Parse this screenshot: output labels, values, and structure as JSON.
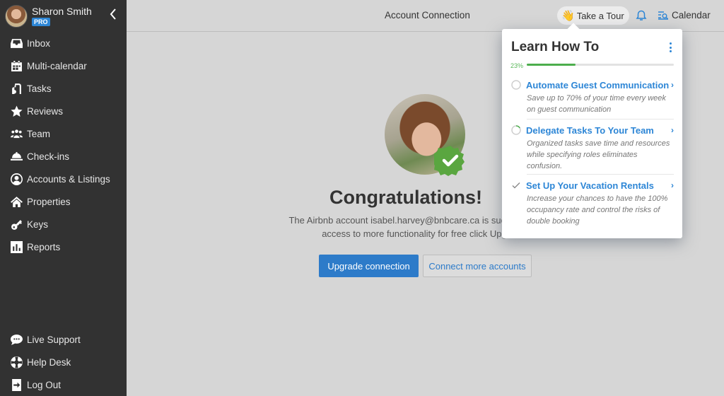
{
  "sidebar": {
    "user": {
      "name": "Sharon Smith",
      "badge": "PRO"
    },
    "collapse_icon": "chevron-left",
    "items": [
      {
        "label": "Inbox",
        "icon": "inbox-icon"
      },
      {
        "label": "Multi-calendar",
        "icon": "calendar-grid-icon"
      },
      {
        "label": "Tasks",
        "icon": "vacuum-icon"
      },
      {
        "label": "Reviews",
        "icon": "star-icon"
      },
      {
        "label": "Team",
        "icon": "team-icon"
      },
      {
        "label": "Check-ins",
        "icon": "bell-desk-icon"
      },
      {
        "label": "Accounts & Listings",
        "icon": "user-circle-icon"
      },
      {
        "label": "Properties",
        "icon": "home-icon"
      },
      {
        "label": "Keys",
        "icon": "key-icon"
      },
      {
        "label": "Reports",
        "icon": "bar-chart-icon"
      }
    ],
    "bottom_items": [
      {
        "label": "Live Support",
        "icon": "chat-icon"
      },
      {
        "label": "Help Desk",
        "icon": "lifebuoy-icon"
      },
      {
        "label": "Log Out",
        "icon": "logout-icon"
      }
    ]
  },
  "header": {
    "title": "Account Connection",
    "tour_emoji": "👋",
    "tour_label": "Take a Tour",
    "calendar_label": "Calendar"
  },
  "main": {
    "heading": "Congratulations!",
    "message_line1": "The Airbnb account isabel.harvey@bnbcare.ca is successfully con",
    "message_line2": "access to more functionality for free click Upgrade",
    "primary_button": "Upgrade connection",
    "secondary_button": "Connect more accounts"
  },
  "learn_popover": {
    "title": "Learn How To",
    "progress_label": "23%",
    "progress_fraction": 0.33,
    "colors": {
      "accent": "#2d86d6",
      "progress": "#4cae4c"
    },
    "tasks": [
      {
        "title": "Automate Guest Communication",
        "status": "not-started",
        "desc": [
          "Save up to 70% of your time every week",
          "on guest communication"
        ]
      },
      {
        "title": "Delegate Tasks To Your Team",
        "status": "in-progress",
        "desc": [
          "Organized tasks save time and resources",
          "while specifying roles eliminates",
          "confusion."
        ]
      },
      {
        "title": "Set Up Your Vacation Rentals",
        "status": "completed",
        "desc": [
          "Increase your chances to have the 100%",
          "occupancy rate and control the risks of",
          "double booking"
        ]
      }
    ]
  }
}
